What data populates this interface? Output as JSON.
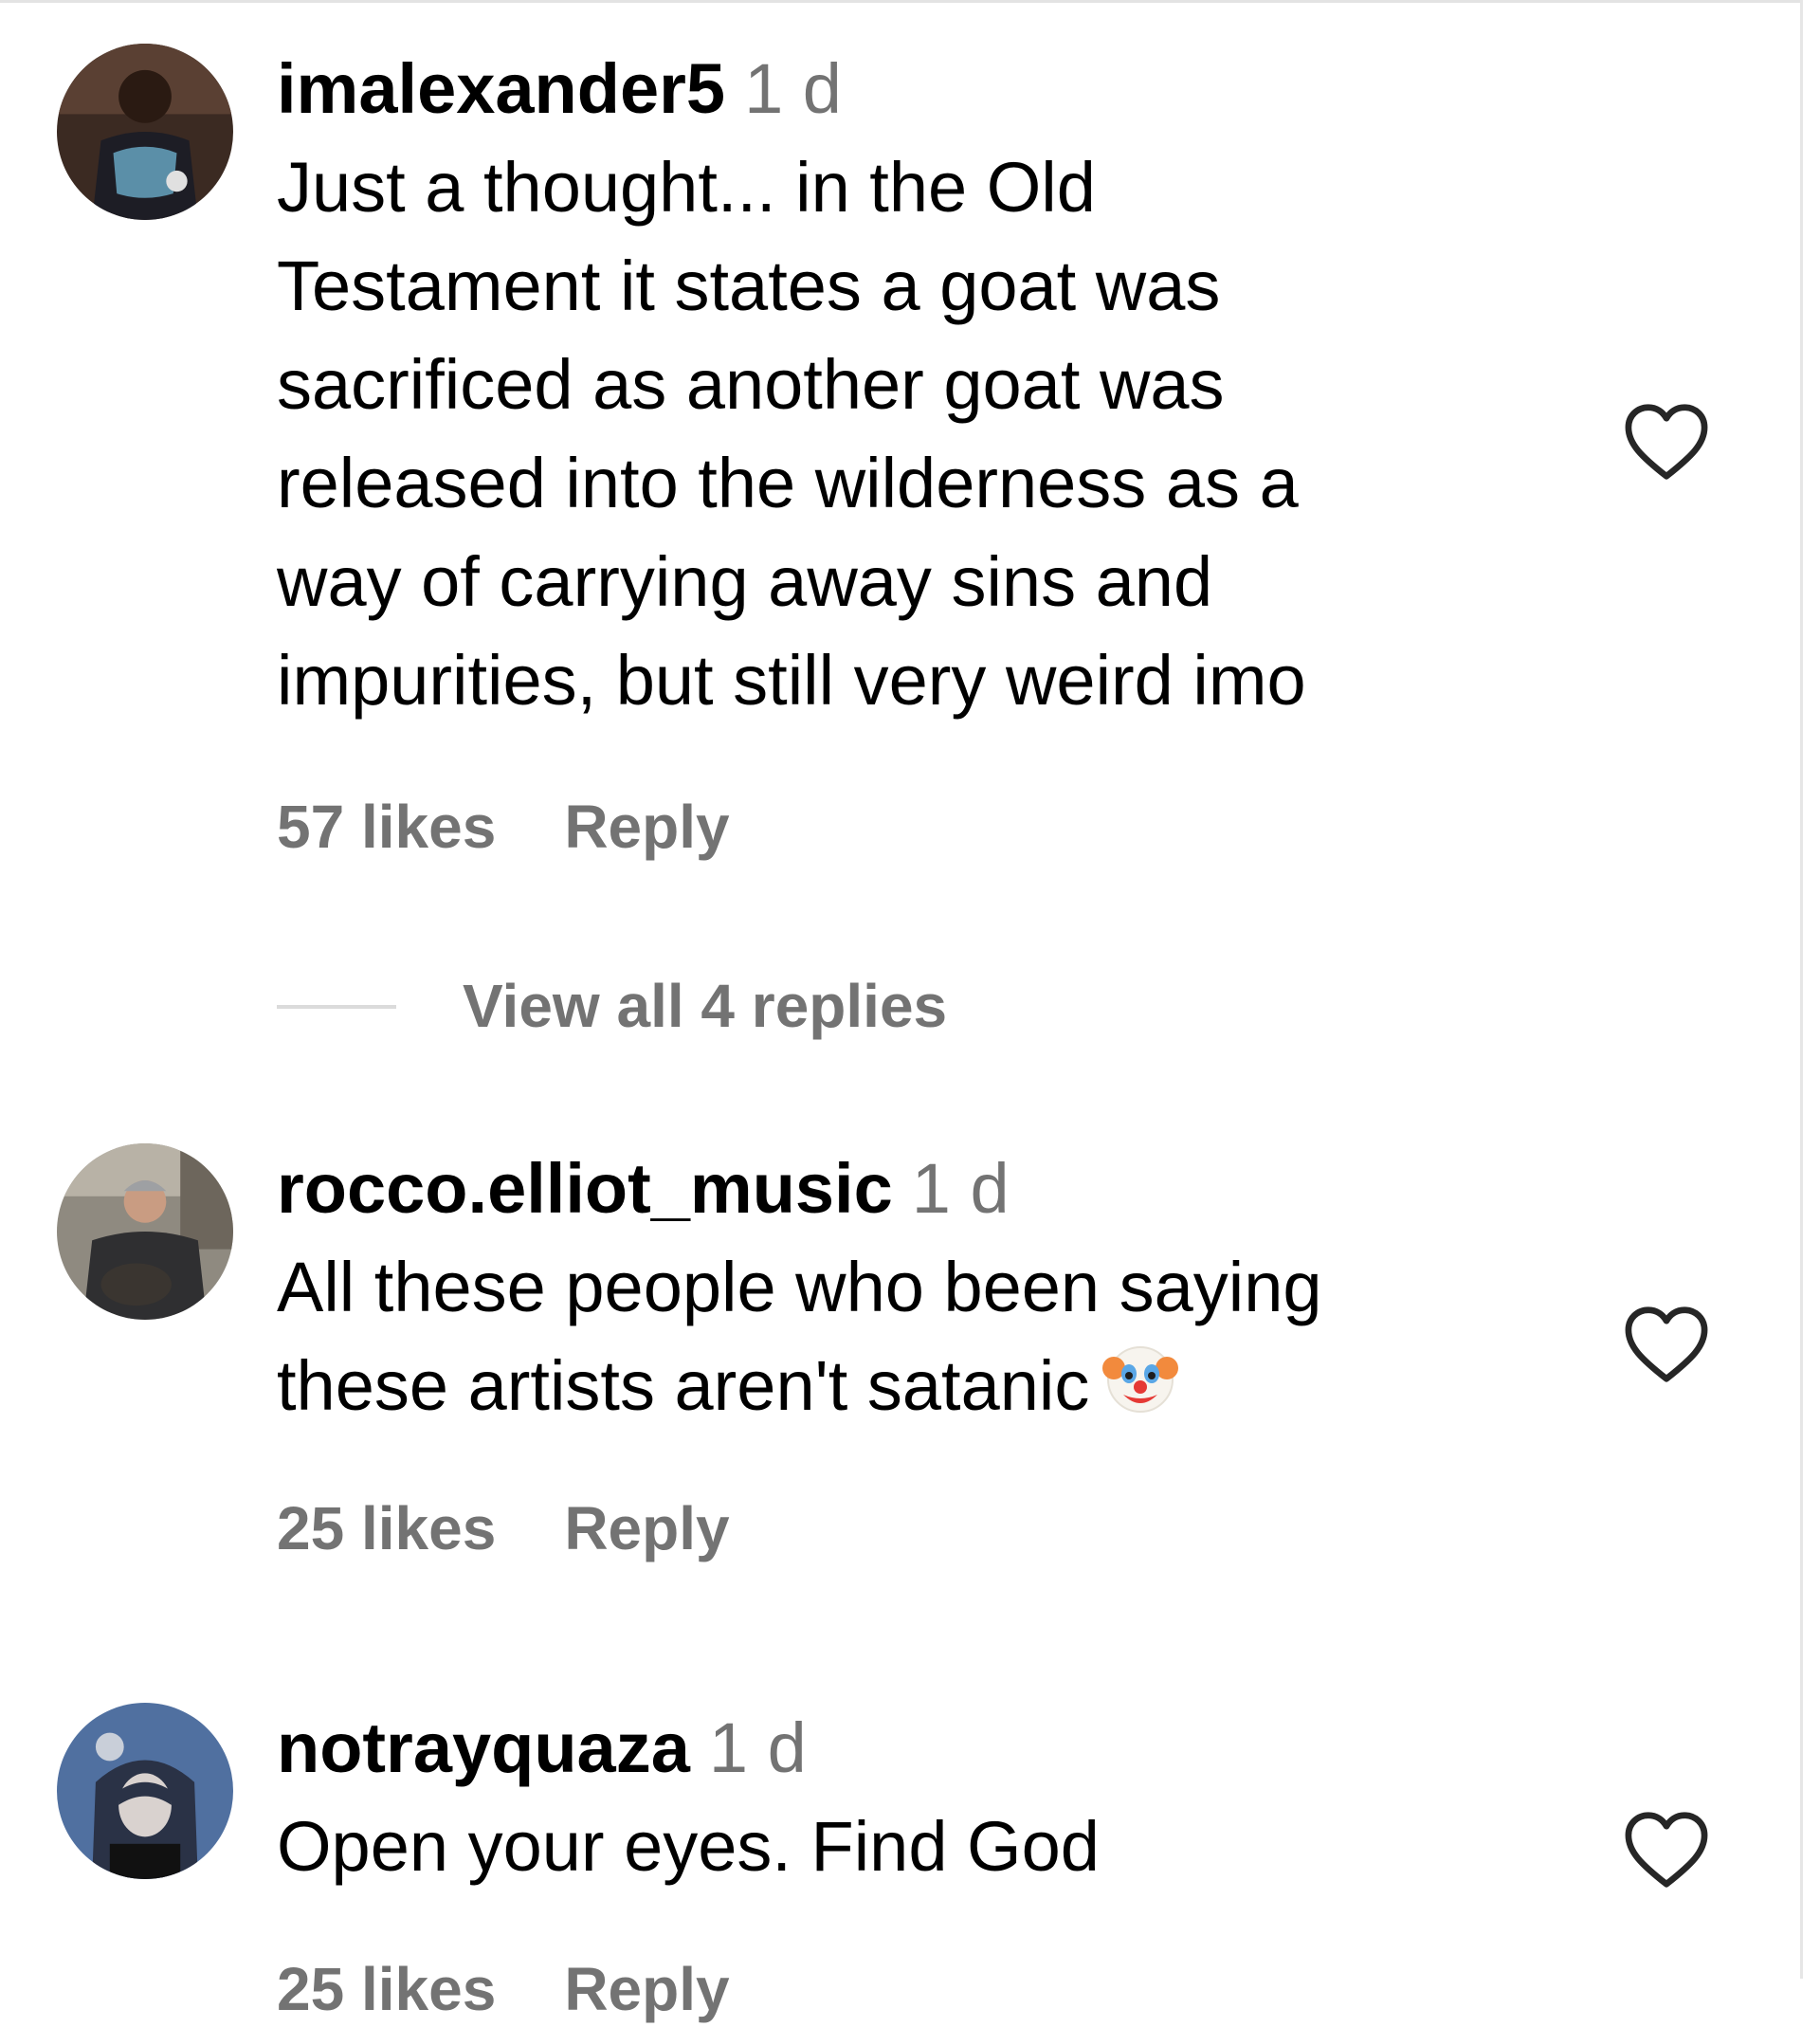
{
  "comments": [
    {
      "username": "imalexander5",
      "time": "1 d",
      "lines": [
        "Just a thought... in the Old",
        "Testament it states a goat was",
        "sacrificed as another goat was",
        "released into the wilderness as a",
        "way of carrying away sins and",
        "impurities, but still very weird imo"
      ],
      "likes": "57 likes",
      "reply": "Reply",
      "view_replies": "View all 4 replies",
      "avatar_icon": "profile-photo"
    },
    {
      "username": "rocco.elliot_music",
      "time": "1 d",
      "lines": [
        "All these people who been saying",
        "these artists aren't satanic"
      ],
      "emoji": "clown-face-emoji",
      "likes": "25 likes",
      "reply": "Reply",
      "avatar_icon": "profile-photo"
    },
    {
      "username": "notrayquaza",
      "time": "1 d",
      "lines": [
        "Open your eyes. Find God"
      ],
      "likes": "25 likes",
      "reply": "Reply",
      "avatar_icon": "profile-photo"
    }
  ],
  "colors": {
    "primary_text": "#000000",
    "secondary_text": "#737373",
    "divider": "#dbdbdb",
    "background": "#ffffff"
  },
  "icons": {
    "like": "heart-outline-icon"
  }
}
